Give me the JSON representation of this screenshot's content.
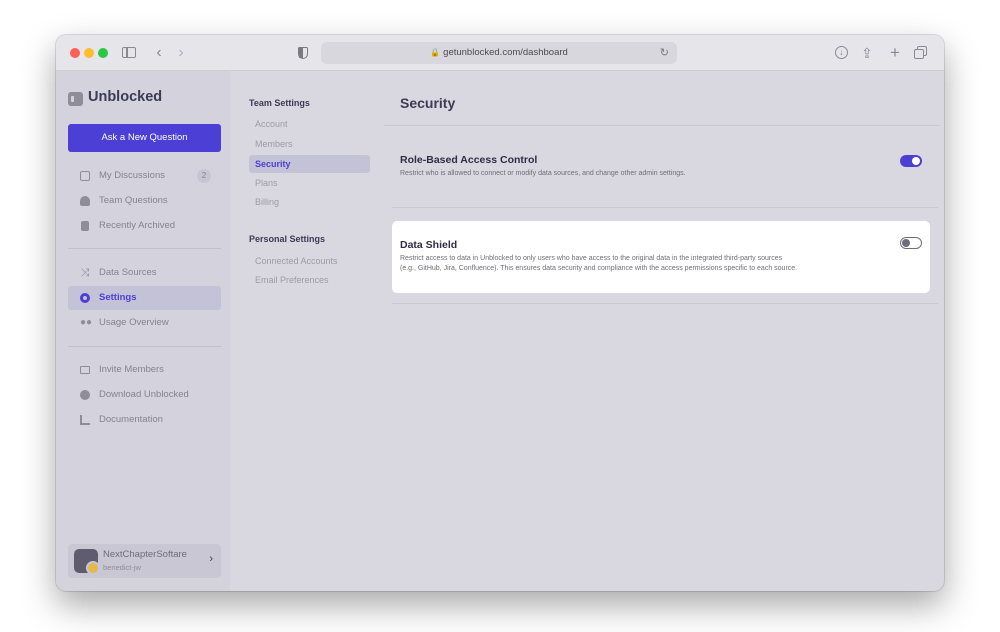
{
  "browser": {
    "url": "getunblocked.com/dashboard"
  },
  "app": {
    "name": "Unblocked",
    "ask_button": "Ask a New Question",
    "nav_primary": [
      {
        "label": "My Discussions",
        "badge": "2",
        "icon": "laptop-icon"
      },
      {
        "label": "Team Questions",
        "icon": "team-icon"
      },
      {
        "label": "Recently Archived",
        "icon": "archive-icon"
      }
    ],
    "nav_secondary": [
      {
        "label": "Data Sources",
        "icon": "shuffle-icon"
      },
      {
        "label": "Settings",
        "icon": "gear-icon",
        "active": true
      },
      {
        "label": "Usage Overview",
        "icon": "users-icon"
      }
    ],
    "nav_tertiary": [
      {
        "label": "Invite Members",
        "icon": "mail-icon"
      },
      {
        "label": "Download Unblocked",
        "icon": "download-icon"
      },
      {
        "label": "Documentation",
        "icon": "document-icon"
      }
    ],
    "account": {
      "name": "NextChapterSoftare",
      "user": "benedict-jw"
    }
  },
  "settings_nav": {
    "team_heading": "Team Settings",
    "team_items": [
      "Account",
      "Members",
      "Security",
      "Plans",
      "Billing"
    ],
    "active_item": "Security",
    "personal_heading": "Personal Settings",
    "personal_items": [
      "Connected Accounts",
      "Email Preferences"
    ]
  },
  "main": {
    "title": "Security",
    "rbac": {
      "title": "Role-Based Access Control",
      "description": "Restrict who is allowed to connect or modify data sources, and change other admin settings.",
      "enabled": true
    },
    "data_shield": {
      "title": "Data Shield",
      "description_line1": "Restrict access to data in Unblocked to only users who have access to the original data in the integrated third-party sources",
      "description_line2": "(e.g., GitHub, Jira, Confluence). This ensures data security and compliance with the access permissions specific to each source.",
      "enabled": false
    }
  },
  "colors": {
    "accent": "#4b3fd6",
    "sidebar_bg": "#d3d2dd",
    "panel_bg": "#d9d8e0"
  }
}
